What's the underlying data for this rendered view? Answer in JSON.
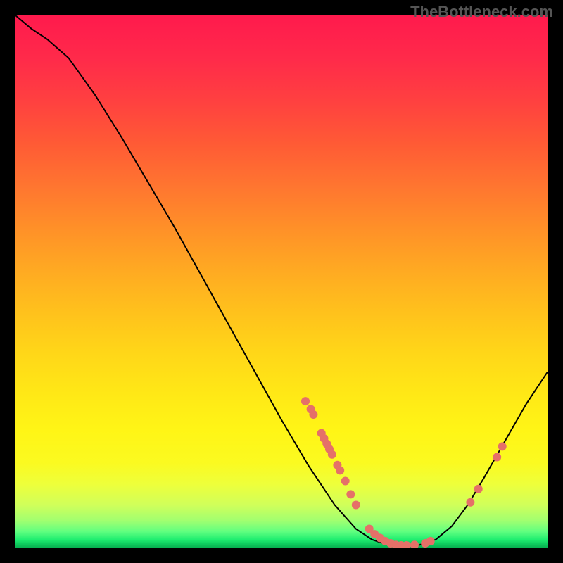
{
  "watermark": "TheBottleneck.com",
  "chart_data": {
    "type": "line",
    "title": "",
    "xlabel": "",
    "ylabel": "",
    "xlim": [
      0,
      100
    ],
    "ylim": [
      0,
      100
    ],
    "curve": [
      {
        "x": 0,
        "y": 100
      },
      {
        "x": 3,
        "y": 97.5
      },
      {
        "x": 6,
        "y": 95.5
      },
      {
        "x": 10,
        "y": 92
      },
      {
        "x": 15,
        "y": 85
      },
      {
        "x": 20,
        "y": 77
      },
      {
        "x": 25,
        "y": 68.5
      },
      {
        "x": 30,
        "y": 60
      },
      {
        "x": 35,
        "y": 51
      },
      {
        "x": 40,
        "y": 42
      },
      {
        "x": 45,
        "y": 33
      },
      {
        "x": 50,
        "y": 24
      },
      {
        "x": 55,
        "y": 15.5
      },
      {
        "x": 60,
        "y": 8
      },
      {
        "x": 64,
        "y": 3.5
      },
      {
        "x": 67,
        "y": 1.5
      },
      {
        "x": 70,
        "y": 0.5
      },
      {
        "x": 73,
        "y": 0.3
      },
      {
        "x": 76,
        "y": 0.5
      },
      {
        "x": 79,
        "y": 1.5
      },
      {
        "x": 82,
        "y": 4
      },
      {
        "x": 85,
        "y": 8
      },
      {
        "x": 88,
        "y": 13
      },
      {
        "x": 92,
        "y": 20
      },
      {
        "x": 96,
        "y": 27
      },
      {
        "x": 100,
        "y": 33
      }
    ],
    "data_points": [
      {
        "x": 54.5,
        "y": 27.5
      },
      {
        "x": 55.5,
        "y": 26
      },
      {
        "x": 56,
        "y": 25
      },
      {
        "x": 57.5,
        "y": 21.5
      },
      {
        "x": 58,
        "y": 20.5
      },
      {
        "x": 58.5,
        "y": 19.5
      },
      {
        "x": 59,
        "y": 18.5
      },
      {
        "x": 59.5,
        "y": 17.5
      },
      {
        "x": 60.5,
        "y": 15.5
      },
      {
        "x": 61,
        "y": 14.5
      },
      {
        "x": 62,
        "y": 12.5
      },
      {
        "x": 63,
        "y": 10
      },
      {
        "x": 64,
        "y": 8
      },
      {
        "x": 66.5,
        "y": 3.5
      },
      {
        "x": 67.5,
        "y": 2.5
      },
      {
        "x": 68.5,
        "y": 1.8
      },
      {
        "x": 69.5,
        "y": 1.2
      },
      {
        "x": 70.5,
        "y": 0.8
      },
      {
        "x": 71.5,
        "y": 0.5
      },
      {
        "x": 72.5,
        "y": 0.4
      },
      {
        "x": 73.5,
        "y": 0.4
      },
      {
        "x": 75,
        "y": 0.5
      },
      {
        "x": 77,
        "y": 0.8
      },
      {
        "x": 78,
        "y": 1.2
      },
      {
        "x": 85.5,
        "y": 8.5
      },
      {
        "x": 87,
        "y": 11
      },
      {
        "x": 90.5,
        "y": 17
      },
      {
        "x": 91.5,
        "y": 19
      }
    ]
  }
}
